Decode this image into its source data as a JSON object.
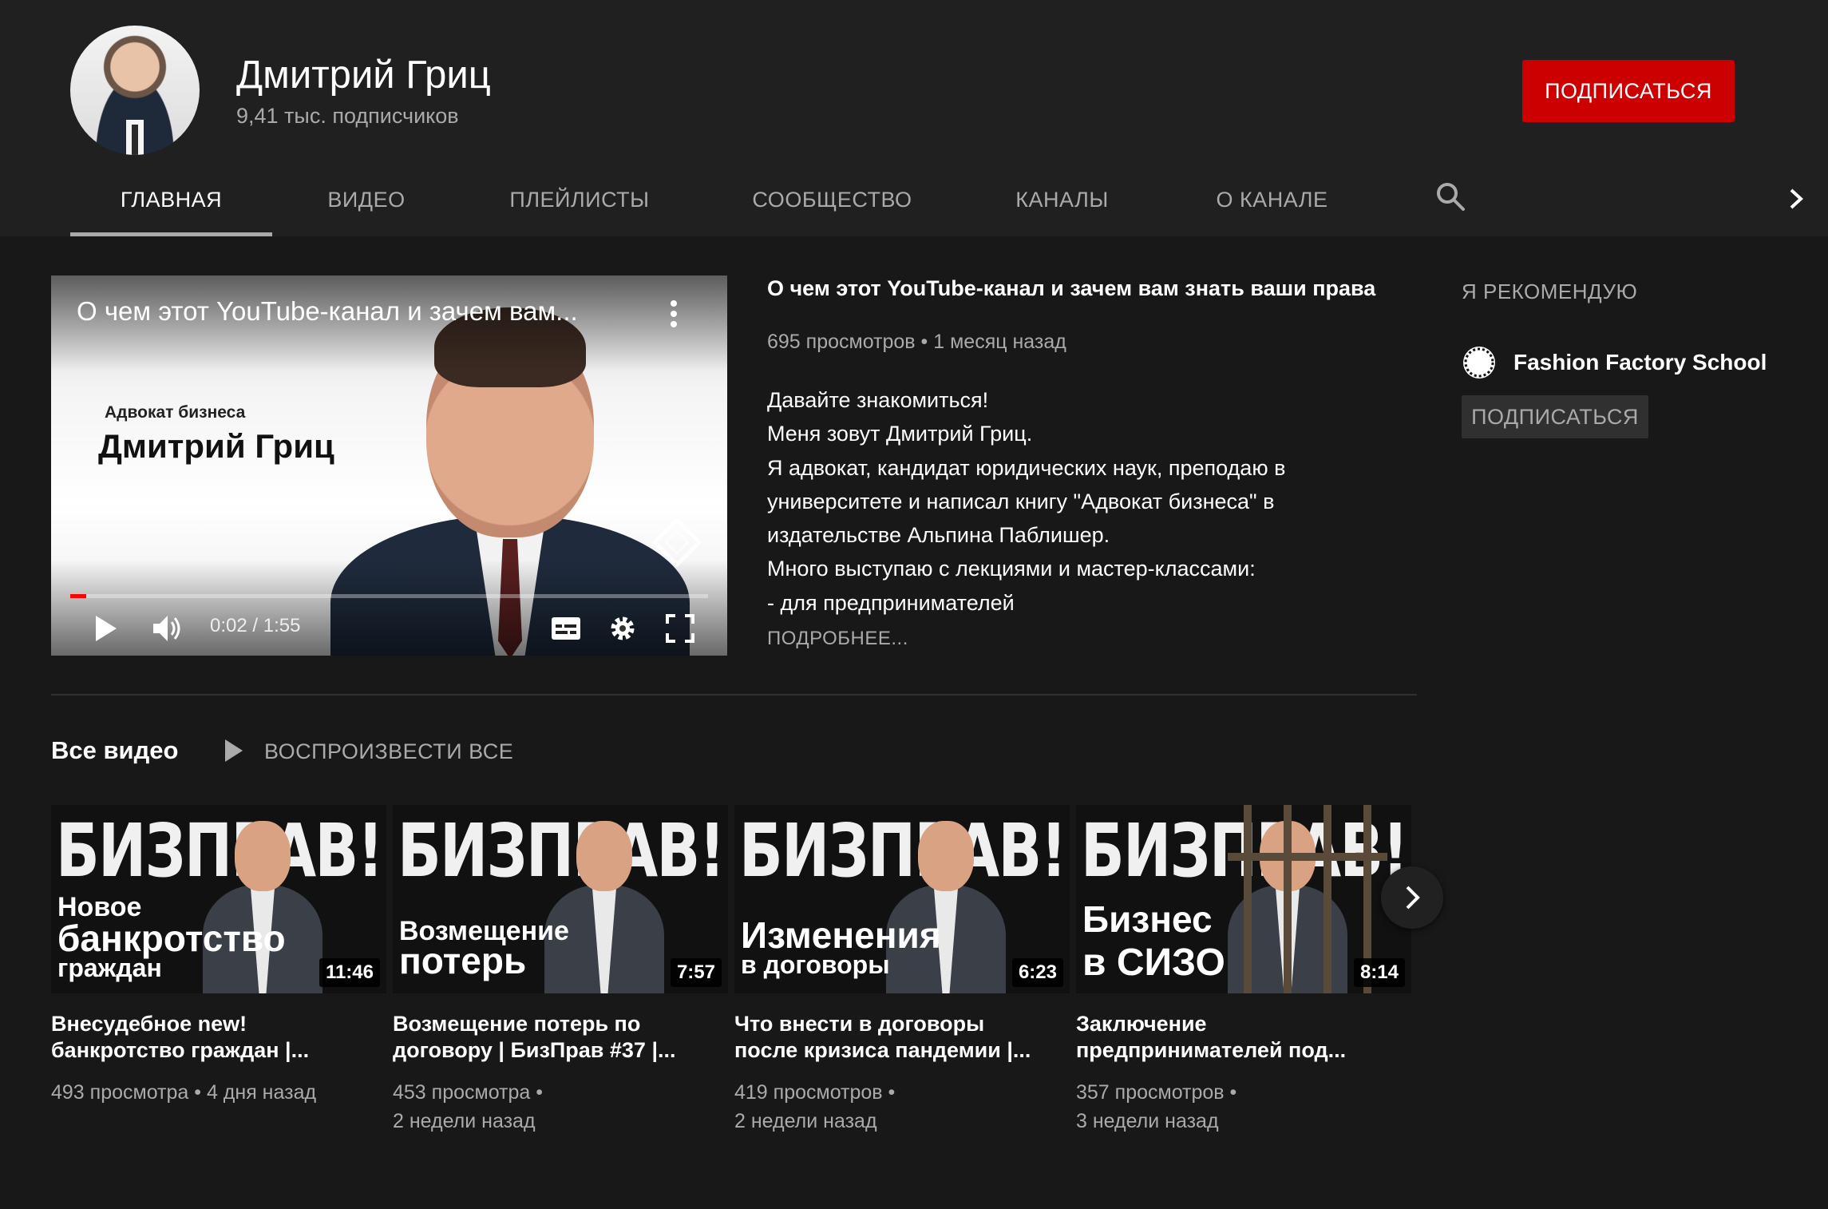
{
  "channel": {
    "name": "Дмитрий Гриц",
    "subscribers": "9,41 тыс. подписчиков",
    "subscribe_label": "ПОДПИСАТЬСЯ"
  },
  "tabs": [
    {
      "label": "ГЛАВНАЯ",
      "active": true
    },
    {
      "label": "ВИДЕО"
    },
    {
      "label": "ПЛЕЙЛИСТЫ"
    },
    {
      "label": "СООБЩЕСТВО"
    },
    {
      "label": "КАНАЛЫ"
    },
    {
      "label": "О КАНАЛЕ"
    }
  ],
  "player": {
    "overlay_title": "О чем этот YouTube-канал и зачем вам...",
    "thumb_small_text": "Адвокат бизнеса",
    "thumb_big_text": "Дмитрий Гриц",
    "time": "0:02 / 1:55",
    "progress": 0.025
  },
  "featured": {
    "title": "О чем этот YouTube-канал и зачем вам знать ваши права",
    "views": "695 просмотров",
    "age": "1 месяц назад",
    "description": [
      "Давайте знакомиться!",
      "Меня зовут Дмитрий Гриц.",
      "Я адвокат, кандидат юридических наук, преподаю в",
      "университете и написал книгу \"Адвокат бизнеса\" в",
      "издательстве Альпина Паблишер.",
      "Много выступаю с лекциями и мастер-классами:",
      "- для предпринимателей"
    ],
    "more_label": "ПОДРОБНЕЕ..."
  },
  "recommend": {
    "title": "Я РЕКОМЕНДУЮ",
    "channel_name": "Fashion Factory School",
    "subscribe_label": "ПОДПИСАТЬСЯ"
  },
  "all_videos": {
    "title": "Все видео",
    "play_all_label": "ВОСПРОИЗВЕСТИ ВСЕ"
  },
  "videos": [
    {
      "brand": "БИЗПРАВ!",
      "cap1": "Новое",
      "cap2": "банкротство",
      "cap3": "граждан",
      "duration": "11:46",
      "title_line1": "Внесудебное new!",
      "title_line2": "банкротство граждан |...",
      "meta_line1": "493 просмотра • 4 дня назад",
      "meta_line2": ""
    },
    {
      "brand": "БИЗПРАВ!",
      "cap1": "Возмещение",
      "cap2": "потерь",
      "cap3": "",
      "duration": "7:57",
      "title_line1": "Возмещение потерь по",
      "title_line2": "договору | БизПрав #37 |...",
      "meta_line1": "453 просмотра •",
      "meta_line2": "2 недели назад"
    },
    {
      "brand": "БИЗПРАВ!",
      "cap1": "",
      "cap2": "Изменения",
      "cap3": "в договоры",
      "duration": "6:23",
      "title_line1": "Что внести в договоры",
      "title_line2": "после кризиса пандемии |...",
      "meta_line1": "419 просмотров •",
      "meta_line2": "2 недели назад"
    },
    {
      "brand": "БИЗПРАВ!",
      "cap1": "",
      "cap2": "Бизнес",
      "cap3": "в СИЗО",
      "duration": "8:14",
      "title_line1": "Заключение",
      "title_line2": "предпринимателей под...",
      "meta_line1": "357 просмотров •",
      "meta_line2": "3 недели назад"
    }
  ],
  "colors": {
    "background": "#181818",
    "header": "#202020",
    "subscribe_red": "#cc0000",
    "secondary_text": "#aaaaaa"
  }
}
